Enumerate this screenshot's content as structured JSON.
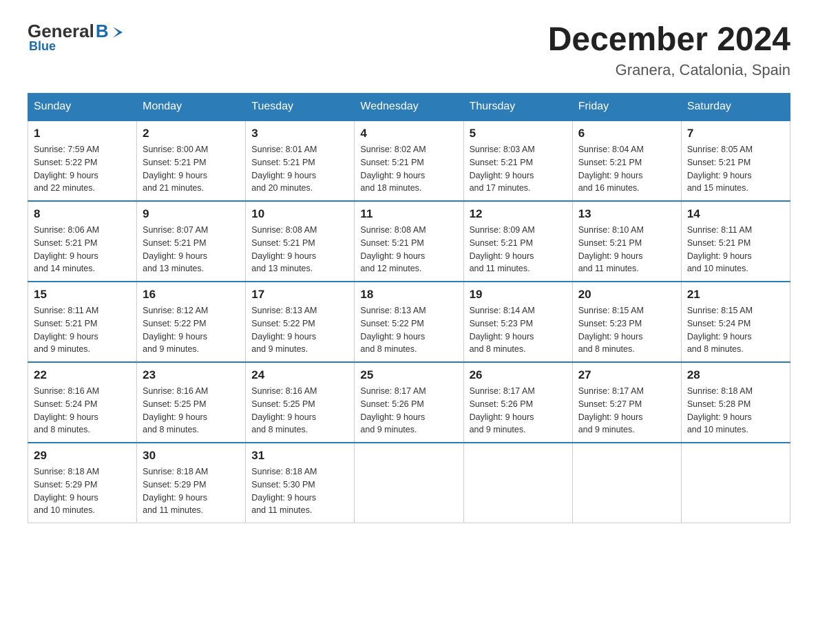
{
  "logo": {
    "general": "General",
    "blue": "Blue",
    "subtitle": "Blue"
  },
  "header": {
    "month": "December 2024",
    "location": "Granera, Catalonia, Spain"
  },
  "days_of_week": [
    "Sunday",
    "Monday",
    "Tuesday",
    "Wednesday",
    "Thursday",
    "Friday",
    "Saturday"
  ],
  "weeks": [
    [
      {
        "day": "1",
        "sunrise": "7:59 AM",
        "sunset": "5:22 PM",
        "daylight": "9 hours and 22 minutes."
      },
      {
        "day": "2",
        "sunrise": "8:00 AM",
        "sunset": "5:21 PM",
        "daylight": "9 hours and 21 minutes."
      },
      {
        "day": "3",
        "sunrise": "8:01 AM",
        "sunset": "5:21 PM",
        "daylight": "9 hours and 20 minutes."
      },
      {
        "day": "4",
        "sunrise": "8:02 AM",
        "sunset": "5:21 PM",
        "daylight": "9 hours and 18 minutes."
      },
      {
        "day": "5",
        "sunrise": "8:03 AM",
        "sunset": "5:21 PM",
        "daylight": "9 hours and 17 minutes."
      },
      {
        "day": "6",
        "sunrise": "8:04 AM",
        "sunset": "5:21 PM",
        "daylight": "9 hours and 16 minutes."
      },
      {
        "day": "7",
        "sunrise": "8:05 AM",
        "sunset": "5:21 PM",
        "daylight": "9 hours and 15 minutes."
      }
    ],
    [
      {
        "day": "8",
        "sunrise": "8:06 AM",
        "sunset": "5:21 PM",
        "daylight": "9 hours and 14 minutes."
      },
      {
        "day": "9",
        "sunrise": "8:07 AM",
        "sunset": "5:21 PM",
        "daylight": "9 hours and 13 minutes."
      },
      {
        "day": "10",
        "sunrise": "8:08 AM",
        "sunset": "5:21 PM",
        "daylight": "9 hours and 13 minutes."
      },
      {
        "day": "11",
        "sunrise": "8:08 AM",
        "sunset": "5:21 PM",
        "daylight": "9 hours and 12 minutes."
      },
      {
        "day": "12",
        "sunrise": "8:09 AM",
        "sunset": "5:21 PM",
        "daylight": "9 hours and 11 minutes."
      },
      {
        "day": "13",
        "sunrise": "8:10 AM",
        "sunset": "5:21 PM",
        "daylight": "9 hours and 11 minutes."
      },
      {
        "day": "14",
        "sunrise": "8:11 AM",
        "sunset": "5:21 PM",
        "daylight": "9 hours and 10 minutes."
      }
    ],
    [
      {
        "day": "15",
        "sunrise": "8:11 AM",
        "sunset": "5:21 PM",
        "daylight": "9 hours and 9 minutes."
      },
      {
        "day": "16",
        "sunrise": "8:12 AM",
        "sunset": "5:22 PM",
        "daylight": "9 hours and 9 minutes."
      },
      {
        "day": "17",
        "sunrise": "8:13 AM",
        "sunset": "5:22 PM",
        "daylight": "9 hours and 9 minutes."
      },
      {
        "day": "18",
        "sunrise": "8:13 AM",
        "sunset": "5:22 PM",
        "daylight": "9 hours and 8 minutes."
      },
      {
        "day": "19",
        "sunrise": "8:14 AM",
        "sunset": "5:23 PM",
        "daylight": "9 hours and 8 minutes."
      },
      {
        "day": "20",
        "sunrise": "8:15 AM",
        "sunset": "5:23 PM",
        "daylight": "9 hours and 8 minutes."
      },
      {
        "day": "21",
        "sunrise": "8:15 AM",
        "sunset": "5:24 PM",
        "daylight": "9 hours and 8 minutes."
      }
    ],
    [
      {
        "day": "22",
        "sunrise": "8:16 AM",
        "sunset": "5:24 PM",
        "daylight": "9 hours and 8 minutes."
      },
      {
        "day": "23",
        "sunrise": "8:16 AM",
        "sunset": "5:25 PM",
        "daylight": "9 hours and 8 minutes."
      },
      {
        "day": "24",
        "sunrise": "8:16 AM",
        "sunset": "5:25 PM",
        "daylight": "9 hours and 8 minutes."
      },
      {
        "day": "25",
        "sunrise": "8:17 AM",
        "sunset": "5:26 PM",
        "daylight": "9 hours and 9 minutes."
      },
      {
        "day": "26",
        "sunrise": "8:17 AM",
        "sunset": "5:26 PM",
        "daylight": "9 hours and 9 minutes."
      },
      {
        "day": "27",
        "sunrise": "8:17 AM",
        "sunset": "5:27 PM",
        "daylight": "9 hours and 9 minutes."
      },
      {
        "day": "28",
        "sunrise": "8:18 AM",
        "sunset": "5:28 PM",
        "daylight": "9 hours and 10 minutes."
      }
    ],
    [
      {
        "day": "29",
        "sunrise": "8:18 AM",
        "sunset": "5:29 PM",
        "daylight": "9 hours and 10 minutes."
      },
      {
        "day": "30",
        "sunrise": "8:18 AM",
        "sunset": "5:29 PM",
        "daylight": "9 hours and 11 minutes."
      },
      {
        "day": "31",
        "sunrise": "8:18 AM",
        "sunset": "5:30 PM",
        "daylight": "9 hours and 11 minutes."
      },
      null,
      null,
      null,
      null
    ]
  ],
  "labels": {
    "sunrise": "Sunrise:",
    "sunset": "Sunset:",
    "daylight": "Daylight:"
  }
}
